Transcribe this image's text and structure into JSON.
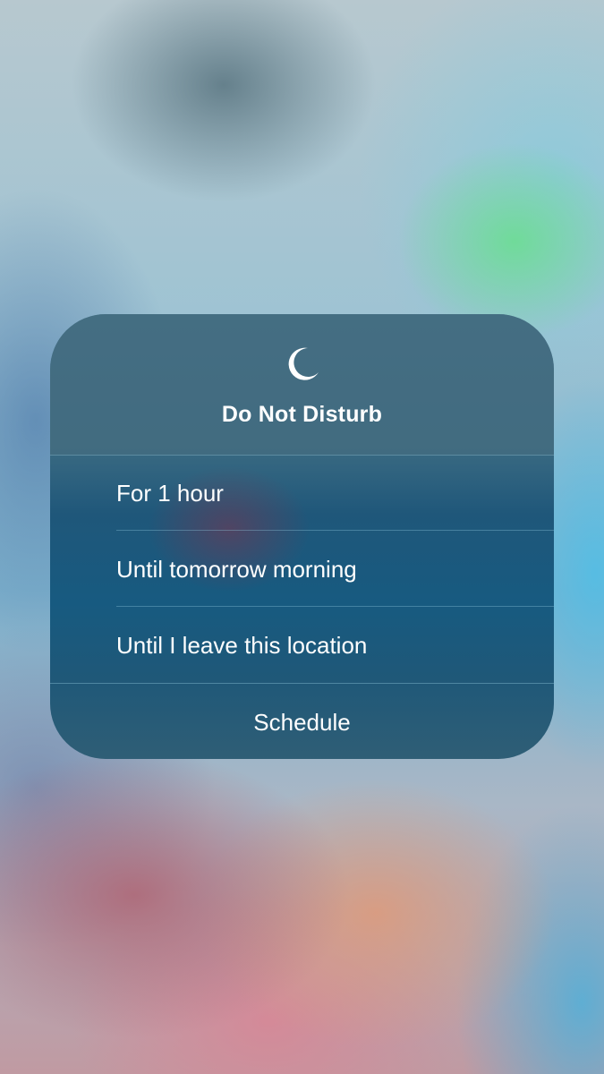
{
  "background": {
    "description_colors": {
      "panel_dark": "#1f577a",
      "panel_header": "#3f6f86",
      "text": "#ffffff"
    }
  },
  "dnd_menu": {
    "icon": "moon-icon",
    "title": "Do Not Disturb",
    "options": [
      {
        "label": "For 1 hour"
      },
      {
        "label": "Until tomorrow morning"
      },
      {
        "label": "Until I leave this location"
      }
    ],
    "schedule_label": "Schedule"
  }
}
